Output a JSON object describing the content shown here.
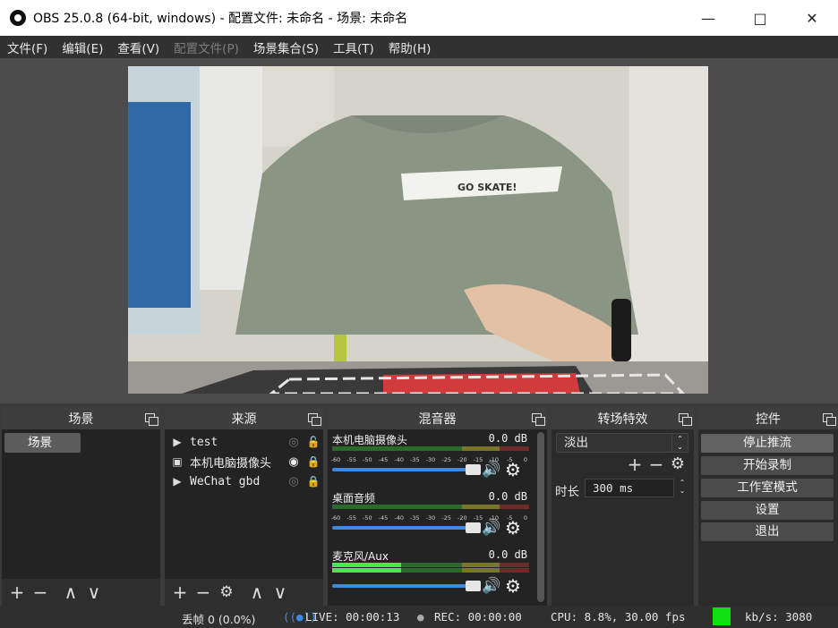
{
  "window": {
    "title": "OBS 25.0.8 (64-bit, windows) - 配置文件: 未命名 - 场景: 未命名",
    "minimize_icon": "minimize-icon",
    "maximize_icon": "maximize-icon",
    "close_icon": "close-icon"
  },
  "menu": [
    {
      "label": "文件(F)",
      "enabled": true
    },
    {
      "label": "编辑(E)",
      "enabled": true
    },
    {
      "label": "查看(V)",
      "enabled": true
    },
    {
      "label": "配置文件(P)",
      "enabled": false
    },
    {
      "label": "场景集合(S)",
      "enabled": true
    },
    {
      "label": "工具(T)",
      "enabled": true
    },
    {
      "label": "帮助(H)",
      "enabled": true
    }
  ],
  "preview": {
    "shirt_text": "GO SKATE!"
  },
  "scenes": {
    "title": "场景",
    "items": [
      "场景"
    ]
  },
  "sources": {
    "title": "来源",
    "items": [
      {
        "name": "test",
        "type_icon": "play-icon",
        "visible": false,
        "locked": false
      },
      {
        "name": "本机电脑摄像头",
        "type_icon": "camera-icon",
        "visible": true,
        "locked": true
      },
      {
        "name": "WeChat gbd",
        "type_icon": "play-icon",
        "visible": false,
        "locked": true
      }
    ]
  },
  "mixer": {
    "title": "混音器",
    "scale_labels": [
      "-60",
      "-55",
      "-50",
      "-45",
      "-40",
      "-35",
      "-30",
      "-25",
      "-20",
      "-15",
      "-10",
      "-5",
      "0"
    ],
    "channels": [
      {
        "name": "本机电脑摄像头",
        "db": "0.0 dB",
        "level": 0.0,
        "volume": 1.0
      },
      {
        "name": "桌面音频",
        "db": "0.0 dB",
        "level": 0.0,
        "volume": 1.0
      },
      {
        "name": "麦克风/Aux",
        "db": "0.0 dB",
        "level": 0.35,
        "volume": 1.0
      }
    ]
  },
  "transitions": {
    "title": "转场特效",
    "selected": "淡出",
    "duration_label": "时长",
    "duration_value": "300 ms"
  },
  "controls": {
    "title": "控件",
    "buttons": [
      "停止推流",
      "开始录制",
      "工作室模式",
      "设置",
      "退出"
    ]
  },
  "status": {
    "dropped": "丢帧 0 (0.0%)",
    "live": "LIVE: 00:00:13",
    "rec": "REC: 00:00:00",
    "cpu": "CPU: 8.8%, 30.00 fps",
    "bitrate": "kb/s: 3080",
    "indicator_color": "#0fe00f"
  }
}
